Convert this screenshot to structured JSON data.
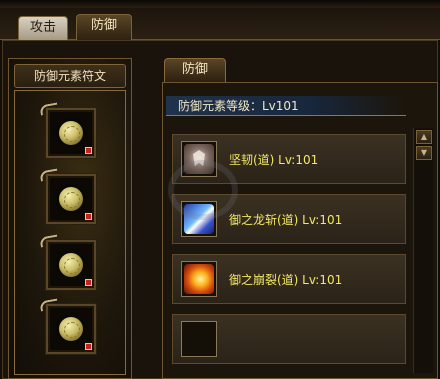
{
  "tabs": {
    "attack": "攻击",
    "defense": "防御"
  },
  "left_panel": {
    "title": "防御元素符文",
    "slots": [
      {
        "icon": "rune-gem-icon"
      },
      {
        "icon": "rune-gem-icon"
      },
      {
        "icon": "rune-gem-icon"
      },
      {
        "icon": "rune-gem-icon"
      }
    ]
  },
  "right_panel": {
    "tab": "防御",
    "element_level": "防御元素等级：Lv101",
    "skills": [
      {
        "name": "坚韧(道) Lv:101",
        "icon": "armor-icon"
      },
      {
        "name": "御之龙斩(道) Lv:101",
        "icon": "dragon-slash-icon"
      },
      {
        "name": "御之崩裂(道) Lv:101",
        "icon": "burst-icon"
      },
      {
        "name": "",
        "icon": "empty-slot-icon"
      }
    ]
  },
  "scrollbar": {
    "up": "▲",
    "down": "▼"
  },
  "colors": {
    "skill_text": "#f2e866",
    "level_bar": "#20324c",
    "badge": "#c7231a"
  }
}
